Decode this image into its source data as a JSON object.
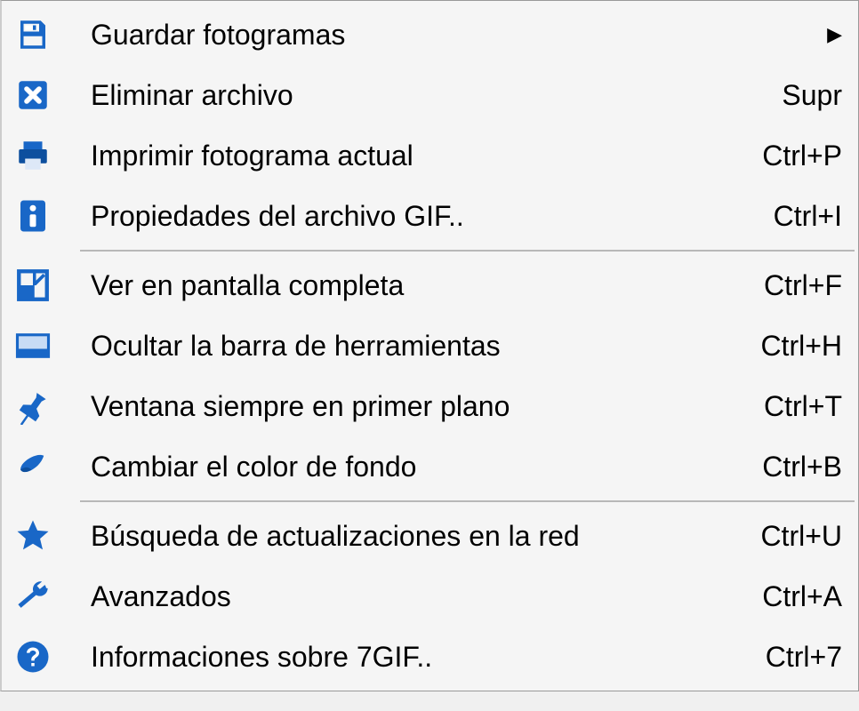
{
  "menu": {
    "groups": [
      [
        {
          "icon": "save-icon",
          "label": "Guardar fotogramas",
          "shortcut": "",
          "submenu": true
        },
        {
          "icon": "delete-icon",
          "label": "Eliminar archivo",
          "shortcut": "Supr",
          "submenu": false
        },
        {
          "icon": "print-icon",
          "label": "Imprimir fotograma actual",
          "shortcut": "Ctrl+P",
          "submenu": false
        },
        {
          "icon": "info-icon",
          "label": "Propiedades del archivo GIF..",
          "shortcut": "Ctrl+I",
          "submenu": false
        }
      ],
      [
        {
          "icon": "fullscreen-icon",
          "label": "Ver en pantalla completa",
          "shortcut": "Ctrl+F",
          "submenu": false
        },
        {
          "icon": "toolbar-icon",
          "label": "Ocultar la barra de herramientas",
          "shortcut": "Ctrl+H",
          "submenu": false
        },
        {
          "icon": "pin-icon",
          "label": "Ventana siempre en primer plano",
          "shortcut": "Ctrl+T",
          "submenu": false
        },
        {
          "icon": "color-icon",
          "label": "Cambiar el color de fondo",
          "shortcut": "Ctrl+B",
          "submenu": false
        }
      ],
      [
        {
          "icon": "star-icon",
          "label": "Búsqueda de actualizaciones en la red",
          "shortcut": "Ctrl+U",
          "submenu": false
        },
        {
          "icon": "wrench-icon",
          "label": "Avanzados",
          "shortcut": "Ctrl+A",
          "submenu": false
        },
        {
          "icon": "help-icon",
          "label": "Informaciones sobre 7GIF..",
          "shortcut": "Ctrl+7",
          "submenu": false
        }
      ]
    ]
  }
}
